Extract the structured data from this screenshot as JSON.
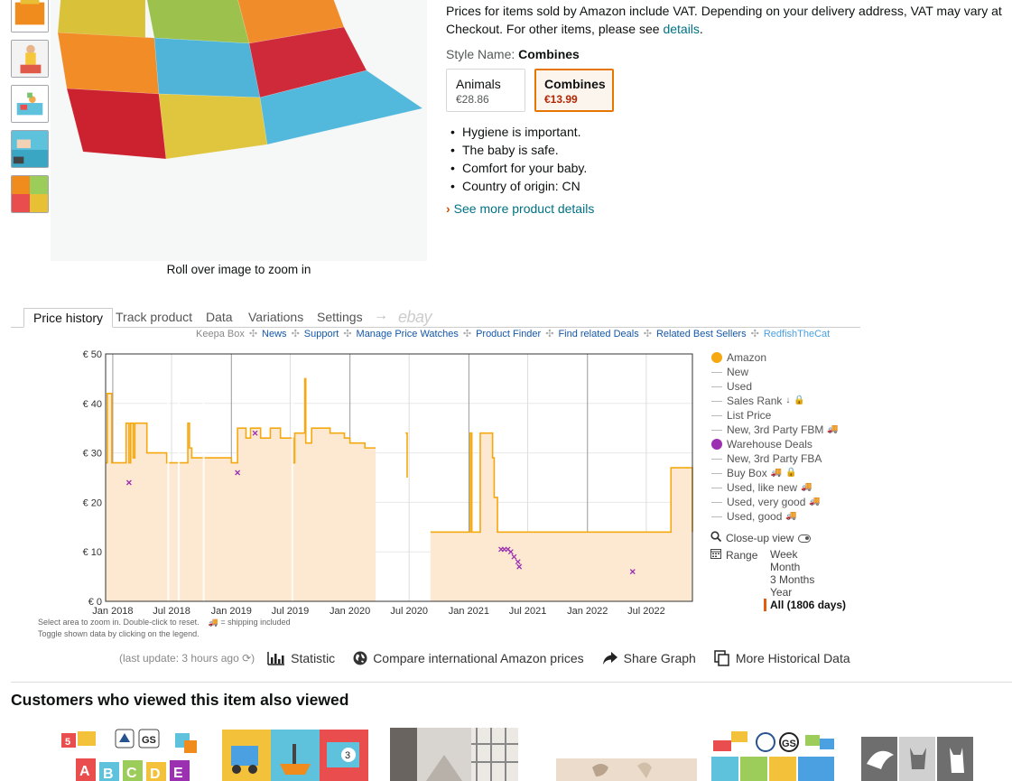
{
  "gallery": {
    "zoom_hint": "Roll over image to zoom in",
    "thumbnail_count": 5
  },
  "product": {
    "vat_text": "Prices for items sold by Amazon include VAT. Depending on your delivery address, VAT may vary at Checkout. For other items, please see ",
    "vat_link": "details",
    "vat_end": ".",
    "style_label": "Style Name: ",
    "style_value": "Combines",
    "style_options": [
      {
        "name": "Animals",
        "price": "€28.86",
        "selected": false
      },
      {
        "name": "Combines",
        "price": "€13.99",
        "selected": true
      }
    ],
    "bullets": [
      "Hygiene is important.",
      "The baby is safe.",
      "Comfort for your baby.",
      "Country of origin: CN"
    ],
    "more_details": "See more product details"
  },
  "keepa": {
    "tabs": [
      "Price history",
      "Track product",
      "Data",
      "Variations",
      "Settings",
      "→",
      "ebay"
    ],
    "links_prefix": "Keepa Box",
    "links": [
      "News",
      "Support",
      "Manage Price Watches",
      "Product Finder",
      "Find related Deals",
      "Related Best Sellers",
      "RedfishTheCat"
    ],
    "note1": "Select area to zoom in. Double-click to reset.",
    "note_ship": "= shipping included",
    "note2": "Toggle shown data by clicking on the legend.",
    "legend": [
      {
        "label": "Amazon",
        "mark": "dot",
        "color": "#f5a80f"
      },
      {
        "label": "New",
        "mark": "line",
        "color": "#bbbbbb"
      },
      {
        "label": "Used",
        "mark": "line",
        "color": "#bbbbbb"
      },
      {
        "label": "Sales Rank",
        "mark": "line",
        "color": "#bbbbbb",
        "extra": "sort-icon lock-icon"
      },
      {
        "label": "List Price",
        "mark": "line",
        "color": "#bbbbbb"
      },
      {
        "label": "New, 3rd Party FBM",
        "mark": "line",
        "color": "#bbbbbb",
        "extra": "truck-icon"
      },
      {
        "label": "Warehouse Deals",
        "mark": "dot",
        "color": "#9b30b0"
      },
      {
        "label": "New, 3rd Party FBA",
        "mark": "line",
        "color": "#bbbbbb"
      },
      {
        "label": "Buy Box",
        "mark": "line",
        "color": "#bbbbbb",
        "extra": "truck-icon lock-icon"
      },
      {
        "label": "Used, like new",
        "mark": "line",
        "color": "#bbbbbb",
        "extra": "truck-icon"
      },
      {
        "label": "Used, very good",
        "mark": "line",
        "color": "#bbbbbb",
        "extra": "truck-icon"
      },
      {
        "label": "Used, good",
        "mark": "line",
        "color": "#bbbbbb",
        "extra": "truck-icon"
      }
    ],
    "closeup_label": "Close-up view",
    "range_label": "Range",
    "range_options": [
      "Week",
      "Month",
      "3 Months",
      "Year",
      "All (1806 days)"
    ],
    "range_selected": 4,
    "last_update": "(last update: 3 hours ago",
    "actions": [
      "Statistic",
      "Compare international Amazon prices",
      "Share Graph",
      "More Historical Data"
    ]
  },
  "also_viewed_title": "Customers who viewed this item also viewed",
  "chart_data": {
    "type": "line",
    "title": "",
    "xlabel": "",
    "ylabel": "",
    "currency": "€",
    "y_ticks": [
      "€ 0",
      "€ 10",
      "€ 20",
      "€ 30",
      "€ 40",
      "€ 50"
    ],
    "ylim": [
      0,
      50
    ],
    "x_ticks": [
      "Jan 2018",
      "Jul 2018",
      "Jan 2019",
      "Jul 2019",
      "Jan 2020",
      "Jul 2020",
      "Jan 2021",
      "Jul 2021",
      "Jan 2022",
      "Jul 2022"
    ],
    "xlim": [
      "2017-12-10",
      "2022-11-20"
    ],
    "grid": true,
    "series": [
      {
        "name": "Amazon",
        "color": "#f5a80f",
        "fill": "#fde8d2",
        "points": [
          [
            "2017-12-10",
            28
          ],
          [
            "2017-12-15",
            42
          ],
          [
            "2017-12-28",
            42
          ],
          [
            "2017-12-29",
            28
          ],
          [
            "2018-02-10",
            28
          ],
          [
            "2018-02-11",
            36
          ],
          [
            "2018-02-20",
            28
          ],
          [
            "2018-02-25",
            36
          ],
          [
            "2018-03-05",
            29
          ],
          [
            "2018-03-10",
            36
          ],
          [
            "2018-04-15",
            36
          ],
          [
            "2018-04-16",
            30
          ],
          [
            "2018-06-15",
            30
          ],
          [
            "2018-06-16",
            28
          ],
          [
            "2018-07-10",
            28
          ],
          [
            "2018-08-20",
            36
          ],
          [
            "2018-08-25",
            31
          ],
          [
            "2018-09-01",
            29
          ],
          [
            "2018-11-01",
            29
          ],
          [
            "2018-12-01",
            29
          ],
          [
            "2019-01-01",
            28
          ],
          [
            "2019-01-20",
            35
          ],
          [
            "2019-02-15",
            33
          ],
          [
            "2019-03-01",
            35
          ],
          [
            "2019-04-01",
            33
          ],
          [
            "2019-05-01",
            35
          ],
          [
            "2019-06-01",
            33
          ],
          [
            "2019-07-01",
            33
          ],
          [
            "2019-07-10",
            28
          ],
          [
            "2019-07-15",
            34
          ],
          [
            "2019-08-10",
            34
          ],
          [
            "2019-08-15",
            45
          ],
          [
            "2019-08-18",
            32
          ],
          [
            "2019-09-05",
            35
          ],
          [
            "2019-10-01",
            35
          ],
          [
            "2019-11-01",
            34
          ],
          [
            "2019-12-15",
            33
          ],
          [
            "2020-01-01",
            32
          ],
          [
            "2020-02-15",
            32
          ],
          [
            "2020-02-16",
            31
          ],
          [
            "2020-03-20",
            31
          ]
        ],
        "segments_after_gap": [
          [
            [
              "2020-06-20",
              34
            ],
            [
              "2020-06-25",
              25
            ]
          ],
          [
            [
              "2020-09-05",
              14
            ],
            [
              "2020-12-31",
              14
            ],
            [
              "2021-01-05",
              34
            ],
            [
              "2021-01-10",
              14
            ],
            [
              "2021-02-01",
              14
            ],
            [
              "2021-02-05",
              34
            ],
            [
              "2021-03-10",
              34
            ],
            [
              "2021-03-15",
              29
            ],
            [
              "2021-03-20",
              21
            ],
            [
              "2021-03-25",
              21
            ],
            [
              "2021-03-30",
              14
            ],
            [
              "2022-09-10",
              14
            ],
            [
              "2022-09-15",
              27
            ],
            [
              "2022-11-10",
              27
            ],
            [
              "2022-11-20",
              14
            ]
          ]
        ]
      },
      {
        "name": "Warehouse Deals",
        "type": "scatter",
        "color": "#9b30b0",
        "points": [
          [
            "2018-02-20",
            24
          ],
          [
            "2019-01-20",
            26
          ],
          [
            "2019-03-15",
            34
          ],
          [
            "2021-04-10",
            10.5
          ],
          [
            "2021-04-20",
            10.5
          ],
          [
            "2021-05-01",
            10.5
          ],
          [
            "2021-05-10",
            10
          ],
          [
            "2021-05-20",
            9
          ],
          [
            "2021-06-01",
            8
          ],
          [
            "2021-06-05",
            7
          ],
          [
            "2022-05-20",
            6
          ]
        ]
      }
    ]
  }
}
